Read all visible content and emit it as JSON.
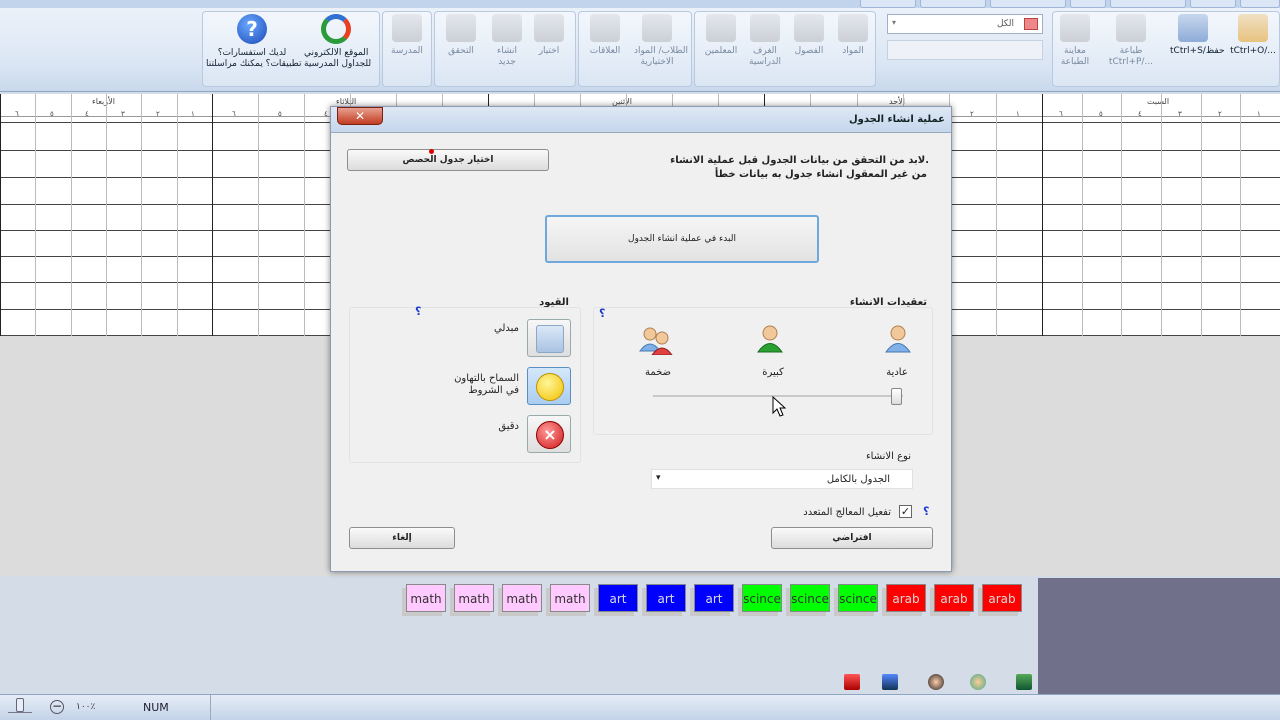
{
  "ribbon": {
    "buttons": [
      {
        "key": "open",
        "label": "tCtrl+O/...",
        "active": true
      },
      {
        "key": "save",
        "label": "tCtrl+S/حفظ",
        "active": true
      },
      {
        "key": "print",
        "label": "طباعة\ntCtrl+P/...",
        "active": false
      },
      {
        "key": "preview",
        "label": "معاينة\nالطباعة",
        "active": false
      },
      {
        "key": "subjects",
        "label": "المواد",
        "active": false
      },
      {
        "key": "classes",
        "label": "الفصول",
        "active": false
      },
      {
        "key": "rooms",
        "label": "الغرف\nالدراسية",
        "active": false
      },
      {
        "key": "teachers",
        "label": "المعلمين",
        "active": false
      },
      {
        "key": "students",
        "label": "الطلاب/ المواد\nالاختيارية",
        "active": false
      },
      {
        "key": "relations",
        "label": "العلاقات",
        "active": false
      },
      {
        "key": "select",
        "label": "اختيار",
        "active": false
      },
      {
        "key": "create",
        "label": "انشاء\nجديد",
        "active": false
      },
      {
        "key": "verify",
        "label": "التحقق",
        "active": false
      },
      {
        "key": "school",
        "label": "المدرسة",
        "active": false
      },
      {
        "key": "website",
        "label": "الموقع الالكتروني\nللجداول المدرسية",
        "active": true
      },
      {
        "key": "help",
        "label": "لديك استفسارات؟\nتطبيقات؟ يمكنك مراسلتنا",
        "active": true
      }
    ],
    "search_value": "الكل",
    "search_arrow": "▾"
  },
  "grid": {
    "days": [
      "السبت",
      "الأحد",
      "الاثنين",
      "الثلاثاء",
      "الأربعاء"
    ],
    "periods": [
      "١",
      "٢",
      "٣",
      "٤",
      "٥",
      "٦"
    ]
  },
  "dialog": {
    "title": "عملية انشاء الجدول",
    "close": "✕",
    "info_line1": "لابد من التحقق من بيانات الجدول قبل عملية الانشاء.",
    "info_line2": "من غير المعقول انشاء جدول به بيانات خطأ",
    "select_assignment_btn": "اختيار جدول الحصص",
    "start_btn": "البدء في عملية انشاء الجدول",
    "complexity_label": "تعقيدات الانشاء",
    "complexity_levels": [
      "عادية",
      "كبيرة",
      "ضخمة"
    ],
    "complexity_value": 0,
    "constraints_label": "القيود",
    "constraint_options": [
      "مبدلي",
      "السماح بالتهاون\nفي الشروط",
      "دقيق"
    ],
    "constraint_selected": 1,
    "help": "؟",
    "type_label": "نوع الانشاء",
    "type_value": "الجدول بالكامل",
    "type_arrow": "▾",
    "multiproc_label": "تفعيل المعالج المتعدد",
    "multiproc_checked": "✓",
    "default_btn": "افتراضي",
    "cancel_btn": "إلغاء"
  },
  "subject_tiles": [
    {
      "label": "math",
      "color": "#ffcaff"
    },
    {
      "label": "math",
      "color": "#ffcaff"
    },
    {
      "label": "math",
      "color": "#ffcaff"
    },
    {
      "label": "math",
      "color": "#ffcaff"
    },
    {
      "label": "art",
      "color": "#0000ff"
    },
    {
      "label": "art",
      "color": "#0000ff"
    },
    {
      "label": "art",
      "color": "#0000ff"
    },
    {
      "label": "scince",
      "color": "#00ff00"
    },
    {
      "label": "scince",
      "color": "#00ff00"
    },
    {
      "label": "scince",
      "color": "#00ff00"
    },
    {
      "label": "arab",
      "color": "#ff0000"
    },
    {
      "label": "arab",
      "color": "#ff0000"
    },
    {
      "label": "arab",
      "color": "#ff0000"
    }
  ],
  "statusbar": {
    "zoom": "١٠٠٪",
    "num": "NUM"
  }
}
